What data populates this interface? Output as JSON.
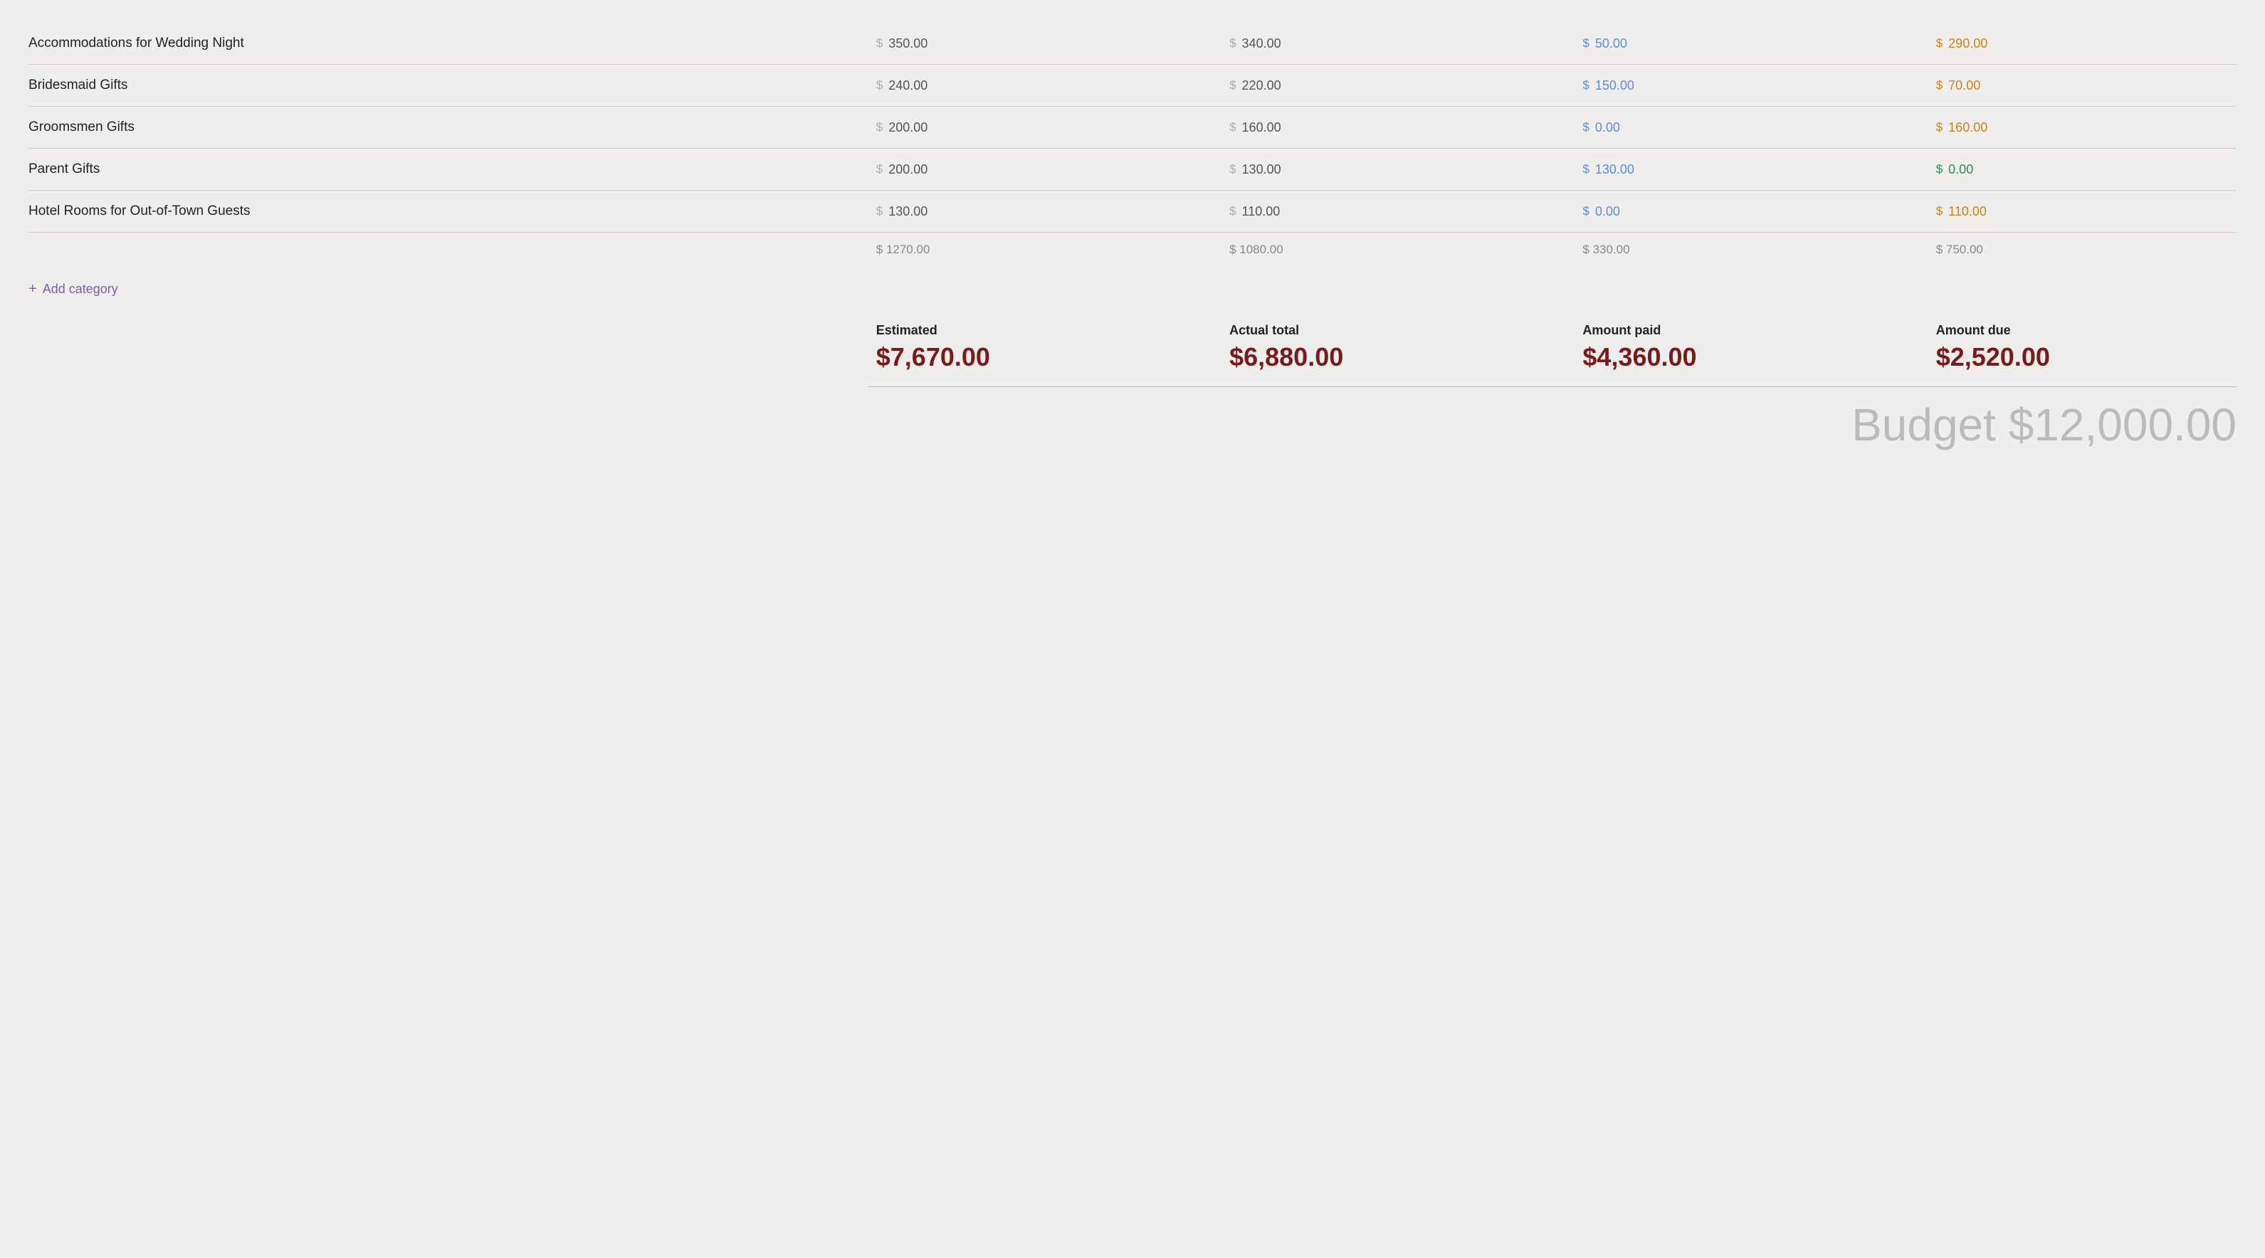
{
  "rows": [
    {
      "name": "Accommodations for Wedding Night",
      "estimated": "350.00",
      "actual": "340.00",
      "paid": "50.00",
      "due": "290.00",
      "due_color": "orange"
    },
    {
      "name": "Bridesmaid Gifts",
      "estimated": "240.00",
      "actual": "220.00",
      "paid": "150.00",
      "due": "70.00",
      "due_color": "orange"
    },
    {
      "name": "Groomsmen Gifts",
      "estimated": "200.00",
      "actual": "160.00",
      "paid": "0.00",
      "due": "160.00",
      "due_color": "orange"
    },
    {
      "name": "Parent Gifts",
      "estimated": "200.00",
      "actual": "130.00",
      "paid": "130.00",
      "due": "0.00",
      "due_color": "green"
    },
    {
      "name": "Hotel Rooms for Out-of-Town Guests",
      "estimated": "130.00",
      "actual": "110.00",
      "paid": "0.00",
      "due": "110.00",
      "due_color": "orange"
    }
  ],
  "subtotals": {
    "estimated": "$ 1270.00",
    "actual": "$ 1080.00",
    "paid": "$ 330.00",
    "due": "$ 750.00"
  },
  "add_category_label": "Add category",
  "totals": {
    "estimated_label": "Estimated",
    "actual_label": "Actual total",
    "paid_label": "Amount paid",
    "due_label": "Amount due",
    "estimated_value": "$7,670.00",
    "actual_value": "$6,880.00",
    "paid_value": "$4,360.00",
    "due_value": "$2,520.00"
  },
  "budget_label": "Budget $12,000.00",
  "dollar_sign": "$",
  "colors": {
    "paid": "#5b8dd9",
    "due_orange": "#c8821a",
    "due_green": "#2e8b57",
    "subtotal_gray": "#888888",
    "total_value": "#7a1a1a",
    "add_category": "#7b5ea7"
  }
}
